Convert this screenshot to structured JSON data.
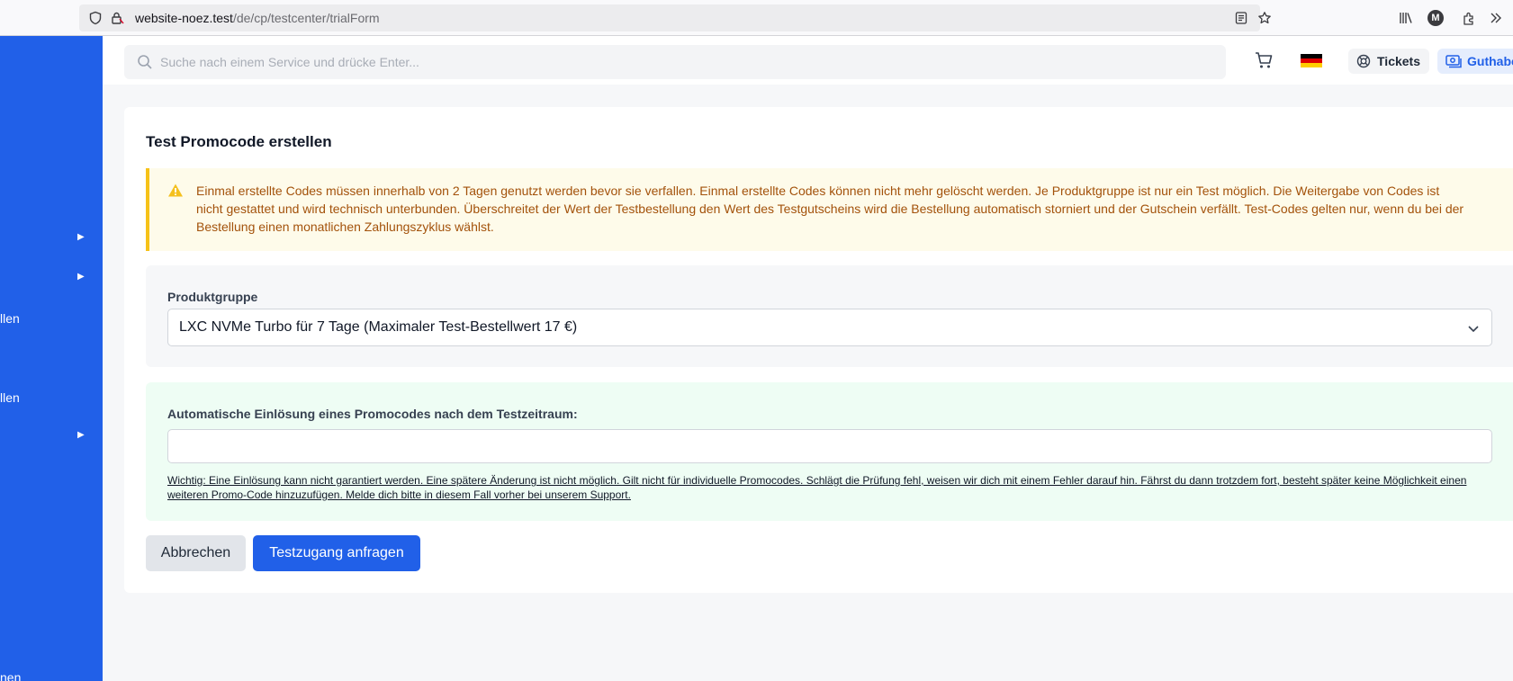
{
  "browser": {
    "url_host": "website-noez.test",
    "url_path": "/de/cp/testcenter/trialForm",
    "profile_initial": "M"
  },
  "sidebar": {
    "items": [
      {
        "label": "",
        "has_arrow": true
      },
      {
        "label": "",
        "has_arrow": true
      },
      {
        "label": "llen",
        "has_arrow": false
      },
      {
        "label": "llen",
        "has_arrow": false
      },
      {
        "label": "",
        "has_arrow": true
      },
      {
        "label": "nen",
        "has_arrow": false
      }
    ],
    "arrow_glyph": "▶"
  },
  "topbar": {
    "search_placeholder": "Suche nach einem Service und drücke Enter...",
    "tickets_label": "Tickets",
    "credit_label": "Guthaben",
    "language_flag": "de"
  },
  "card": {
    "title": "Test Promocode erstellen",
    "warning_text": "Einmal erstellte Codes müssen innerhalb von 2 Tagen genutzt werden bevor sie verfallen. Einmal erstellte Codes können nicht mehr gelöscht werden. Je Produktgruppe ist nur ein Test möglich. Die Weitergabe von Codes ist nicht gestattet und wird technisch unterbunden. Überschreitet der Wert der Testbestellung den Wert des Testgutscheins wird die Bestellung automatisch storniert und der Gutschein verfällt. Test-Codes gelten nur, wenn du bei der Bestellung einen monatlichen Zahlungszyklus wählst.",
    "product_group_label": "Produktgruppe",
    "product_group_value": "LXC NVMe Turbo für 7 Tage (Maximaler Test-Bestellwert 17 €)",
    "promo_label": "Automatische Einlösung eines Promocodes nach dem Testzeitraum:",
    "promo_value": "",
    "promo_note": "Wichtig: Eine Einlösung kann nicht garantiert werden. Eine spätere Änderung ist nicht möglich. Gilt nicht für individuelle Promocodes. Schlägt die Prüfung fehl, weisen wir dich mit einem Fehler darauf hin. Fährst du dann trotzdem fort, besteht später keine Möglichkeit einen weiteren Promo-Code hinzuzufügen. Melde dich bitte in diesem Fall vorher bei unserem Support.",
    "cancel_label": "Abbrechen",
    "submit_label": "Testzugang anfragen"
  },
  "colors": {
    "accent": "#2160e8",
    "warning_bg": "#fefbea",
    "warning_border": "#f6c218",
    "warning_text": "#a3520b",
    "promo_bg": "#eefdf4"
  }
}
